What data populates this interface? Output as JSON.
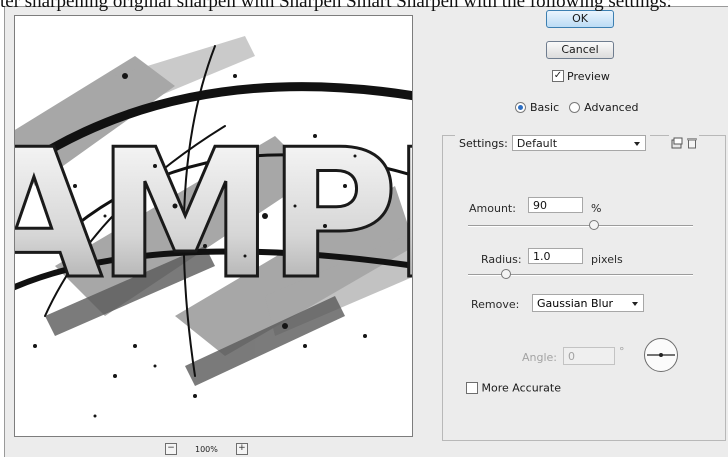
{
  "caption": {
    "text": "ter sharpening original sharpen with Sharpen Smart Sharpen with the following settings:"
  },
  "preview": {
    "artwork_text": "AMPLE",
    "zoom_level": "100%",
    "zoom_out": "−",
    "zoom_in": "+"
  },
  "buttons": {
    "ok": "OK",
    "cancel": "Cancel"
  },
  "preview_checkbox": {
    "label": "Preview",
    "checked": true,
    "mark": "✓"
  },
  "mode": {
    "basic": "Basic",
    "advanced": "Advanced",
    "selected": "basic"
  },
  "settings": {
    "label": "Settings:",
    "value": "Default"
  },
  "amount": {
    "label": "Amount:",
    "value": "90",
    "unit": "%",
    "slider_fraction": 0.56
  },
  "radius": {
    "label": "Radius:",
    "value": "1.0",
    "unit": "pixels",
    "slider_fraction": 0.17
  },
  "remove": {
    "label": "Remove:",
    "value": "Gaussian Blur"
  },
  "angle": {
    "label": "Angle:",
    "value": "0",
    "unit": "°"
  },
  "more_accurate": {
    "label": "More Accurate",
    "checked": false
  },
  "colors": {
    "ok_accent": "#bcdcf5",
    "radio_on": "#2d6fc4",
    "dialog_bg": "#ececec"
  }
}
